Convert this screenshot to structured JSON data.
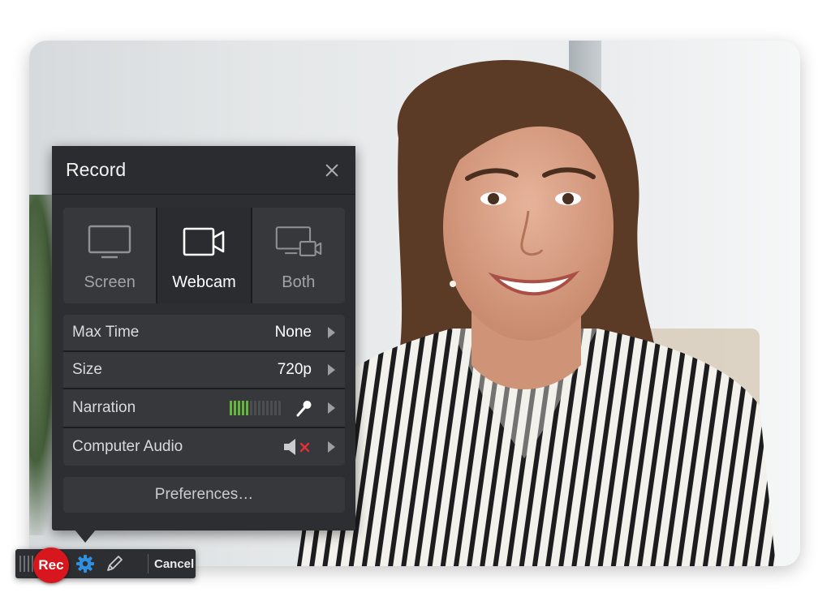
{
  "panel": {
    "title": "Record",
    "close_icon": "close-icon"
  },
  "modes": [
    {
      "label": "Screen",
      "icon": "monitor-icon",
      "active": false
    },
    {
      "label": "Webcam",
      "icon": "webcam-icon",
      "active": true
    },
    {
      "label": "Both",
      "icon": "screen-and-webcam-icon",
      "active": false
    }
  ],
  "settings": [
    {
      "label": "Max Time",
      "value": "None"
    },
    {
      "label": "Size",
      "value": "720p"
    },
    {
      "label": "Narration",
      "meter_level": 0.4,
      "icon": "microphone-icon"
    },
    {
      "label": "Computer Audio",
      "icon": "speaker-muted-icon"
    }
  ],
  "preferences_label": "Preferences…",
  "toolbar": {
    "rec_label": "Rec",
    "cancel_label": "Cancel",
    "settings_icon": "gear-icon",
    "draw_icon": "pencil-icon"
  },
  "colors": {
    "panel_bg": "#2c2e31",
    "row_bg": "#36383c",
    "rec_red": "#d8161d",
    "meter_green": "#63b83c",
    "gear_blue": "#2f8fe0",
    "mute_red": "#e0303a"
  }
}
